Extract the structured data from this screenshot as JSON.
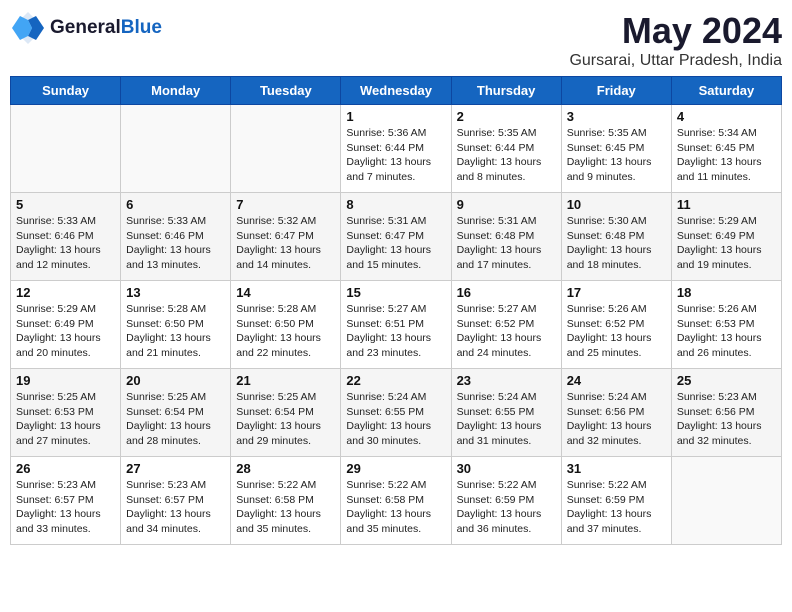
{
  "header": {
    "logo_general": "General",
    "logo_blue": "Blue",
    "month_title": "May 2024",
    "location": "Gursarai, Uttar Pradesh, India"
  },
  "days_of_week": [
    "Sunday",
    "Monday",
    "Tuesday",
    "Wednesday",
    "Thursday",
    "Friday",
    "Saturday"
  ],
  "weeks": [
    [
      {
        "day": "",
        "content": ""
      },
      {
        "day": "",
        "content": ""
      },
      {
        "day": "",
        "content": ""
      },
      {
        "day": "1",
        "content": "Sunrise: 5:36 AM\nSunset: 6:44 PM\nDaylight: 13 hours\nand 7 minutes."
      },
      {
        "day": "2",
        "content": "Sunrise: 5:35 AM\nSunset: 6:44 PM\nDaylight: 13 hours\nand 8 minutes."
      },
      {
        "day": "3",
        "content": "Sunrise: 5:35 AM\nSunset: 6:45 PM\nDaylight: 13 hours\nand 9 minutes."
      },
      {
        "day": "4",
        "content": "Sunrise: 5:34 AM\nSunset: 6:45 PM\nDaylight: 13 hours\nand 11 minutes."
      }
    ],
    [
      {
        "day": "5",
        "content": "Sunrise: 5:33 AM\nSunset: 6:46 PM\nDaylight: 13 hours\nand 12 minutes."
      },
      {
        "day": "6",
        "content": "Sunrise: 5:33 AM\nSunset: 6:46 PM\nDaylight: 13 hours\nand 13 minutes."
      },
      {
        "day": "7",
        "content": "Sunrise: 5:32 AM\nSunset: 6:47 PM\nDaylight: 13 hours\nand 14 minutes."
      },
      {
        "day": "8",
        "content": "Sunrise: 5:31 AM\nSunset: 6:47 PM\nDaylight: 13 hours\nand 15 minutes."
      },
      {
        "day": "9",
        "content": "Sunrise: 5:31 AM\nSunset: 6:48 PM\nDaylight: 13 hours\nand 17 minutes."
      },
      {
        "day": "10",
        "content": "Sunrise: 5:30 AM\nSunset: 6:48 PM\nDaylight: 13 hours\nand 18 minutes."
      },
      {
        "day": "11",
        "content": "Sunrise: 5:29 AM\nSunset: 6:49 PM\nDaylight: 13 hours\nand 19 minutes."
      }
    ],
    [
      {
        "day": "12",
        "content": "Sunrise: 5:29 AM\nSunset: 6:49 PM\nDaylight: 13 hours\nand 20 minutes."
      },
      {
        "day": "13",
        "content": "Sunrise: 5:28 AM\nSunset: 6:50 PM\nDaylight: 13 hours\nand 21 minutes."
      },
      {
        "day": "14",
        "content": "Sunrise: 5:28 AM\nSunset: 6:50 PM\nDaylight: 13 hours\nand 22 minutes."
      },
      {
        "day": "15",
        "content": "Sunrise: 5:27 AM\nSunset: 6:51 PM\nDaylight: 13 hours\nand 23 minutes."
      },
      {
        "day": "16",
        "content": "Sunrise: 5:27 AM\nSunset: 6:52 PM\nDaylight: 13 hours\nand 24 minutes."
      },
      {
        "day": "17",
        "content": "Sunrise: 5:26 AM\nSunset: 6:52 PM\nDaylight: 13 hours\nand 25 minutes."
      },
      {
        "day": "18",
        "content": "Sunrise: 5:26 AM\nSunset: 6:53 PM\nDaylight: 13 hours\nand 26 minutes."
      }
    ],
    [
      {
        "day": "19",
        "content": "Sunrise: 5:25 AM\nSunset: 6:53 PM\nDaylight: 13 hours\nand 27 minutes."
      },
      {
        "day": "20",
        "content": "Sunrise: 5:25 AM\nSunset: 6:54 PM\nDaylight: 13 hours\nand 28 minutes."
      },
      {
        "day": "21",
        "content": "Sunrise: 5:25 AM\nSunset: 6:54 PM\nDaylight: 13 hours\nand 29 minutes."
      },
      {
        "day": "22",
        "content": "Sunrise: 5:24 AM\nSunset: 6:55 PM\nDaylight: 13 hours\nand 30 minutes."
      },
      {
        "day": "23",
        "content": "Sunrise: 5:24 AM\nSunset: 6:55 PM\nDaylight: 13 hours\nand 31 minutes."
      },
      {
        "day": "24",
        "content": "Sunrise: 5:24 AM\nSunset: 6:56 PM\nDaylight: 13 hours\nand 32 minutes."
      },
      {
        "day": "25",
        "content": "Sunrise: 5:23 AM\nSunset: 6:56 PM\nDaylight: 13 hours\nand 32 minutes."
      }
    ],
    [
      {
        "day": "26",
        "content": "Sunrise: 5:23 AM\nSunset: 6:57 PM\nDaylight: 13 hours\nand 33 minutes."
      },
      {
        "day": "27",
        "content": "Sunrise: 5:23 AM\nSunset: 6:57 PM\nDaylight: 13 hours\nand 34 minutes."
      },
      {
        "day": "28",
        "content": "Sunrise: 5:22 AM\nSunset: 6:58 PM\nDaylight: 13 hours\nand 35 minutes."
      },
      {
        "day": "29",
        "content": "Sunrise: 5:22 AM\nSunset: 6:58 PM\nDaylight: 13 hours\nand 35 minutes."
      },
      {
        "day": "30",
        "content": "Sunrise: 5:22 AM\nSunset: 6:59 PM\nDaylight: 13 hours\nand 36 minutes."
      },
      {
        "day": "31",
        "content": "Sunrise: 5:22 AM\nSunset: 6:59 PM\nDaylight: 13 hours\nand 37 minutes."
      },
      {
        "day": "",
        "content": ""
      }
    ]
  ]
}
